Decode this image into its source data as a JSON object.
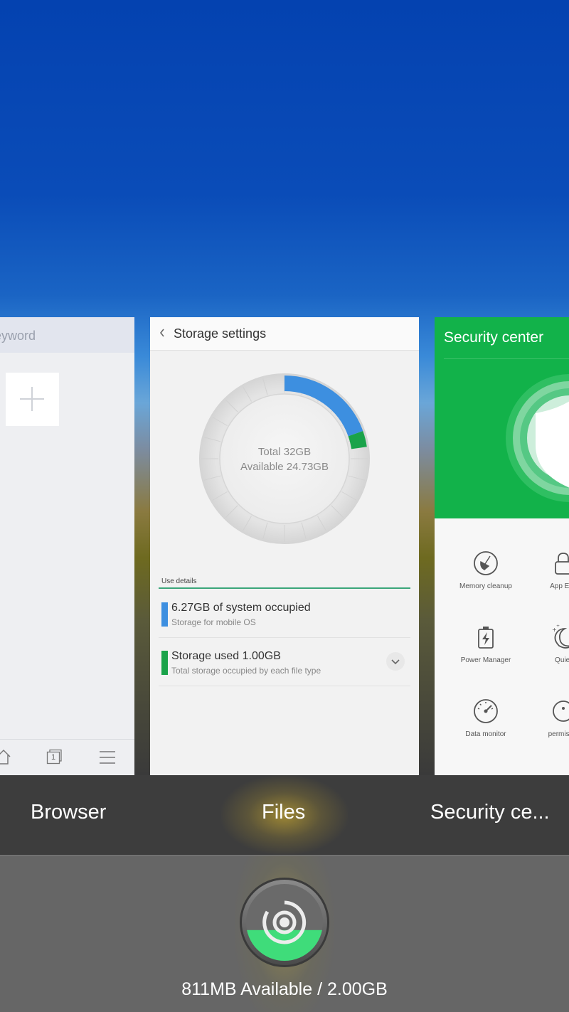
{
  "recents": {
    "browser": {
      "search_placeholder": "eyword",
      "add_icon": "plus-icon",
      "toolbar_icons": [
        "home-icon",
        "tabs-icon",
        "menu-icon"
      ],
      "tab_count": "1"
    },
    "files": {
      "header_title": "Storage settings",
      "total": "Total 32GB",
      "available": "Available 24.73GB",
      "chart_colors": {
        "system": "#3d8fe0",
        "used": "#1aa34a"
      },
      "use_details_label": "Use details",
      "rows": [
        {
          "title": "6.27GB of system occupied",
          "subtitle": "Storage for mobile OS",
          "color": "#3d8fe0"
        },
        {
          "title": "Storage used 1.00GB",
          "subtitle": "Total storage occupied by each file type",
          "color": "#1aa34a"
        }
      ]
    },
    "security": {
      "title": "Security center",
      "tools": [
        {
          "label": "Memory cleanup",
          "icon": "broom-icon"
        },
        {
          "label": "App Enc",
          "icon": "lock-icon"
        },
        {
          "label": "Power Manager",
          "icon": "battery-icon"
        },
        {
          "label": "Quiet",
          "icon": "moon-icon"
        },
        {
          "label": "Data monitor",
          "icon": "gauge-icon"
        },
        {
          "label": "permissio",
          "icon": "permission-icon"
        }
      ]
    }
  },
  "labels": {
    "browser": "Browser",
    "files": "Files",
    "security": "Security ce..."
  },
  "memory": {
    "text": "811MB Available / 2.00GB",
    "fill_fraction": 0.4
  }
}
